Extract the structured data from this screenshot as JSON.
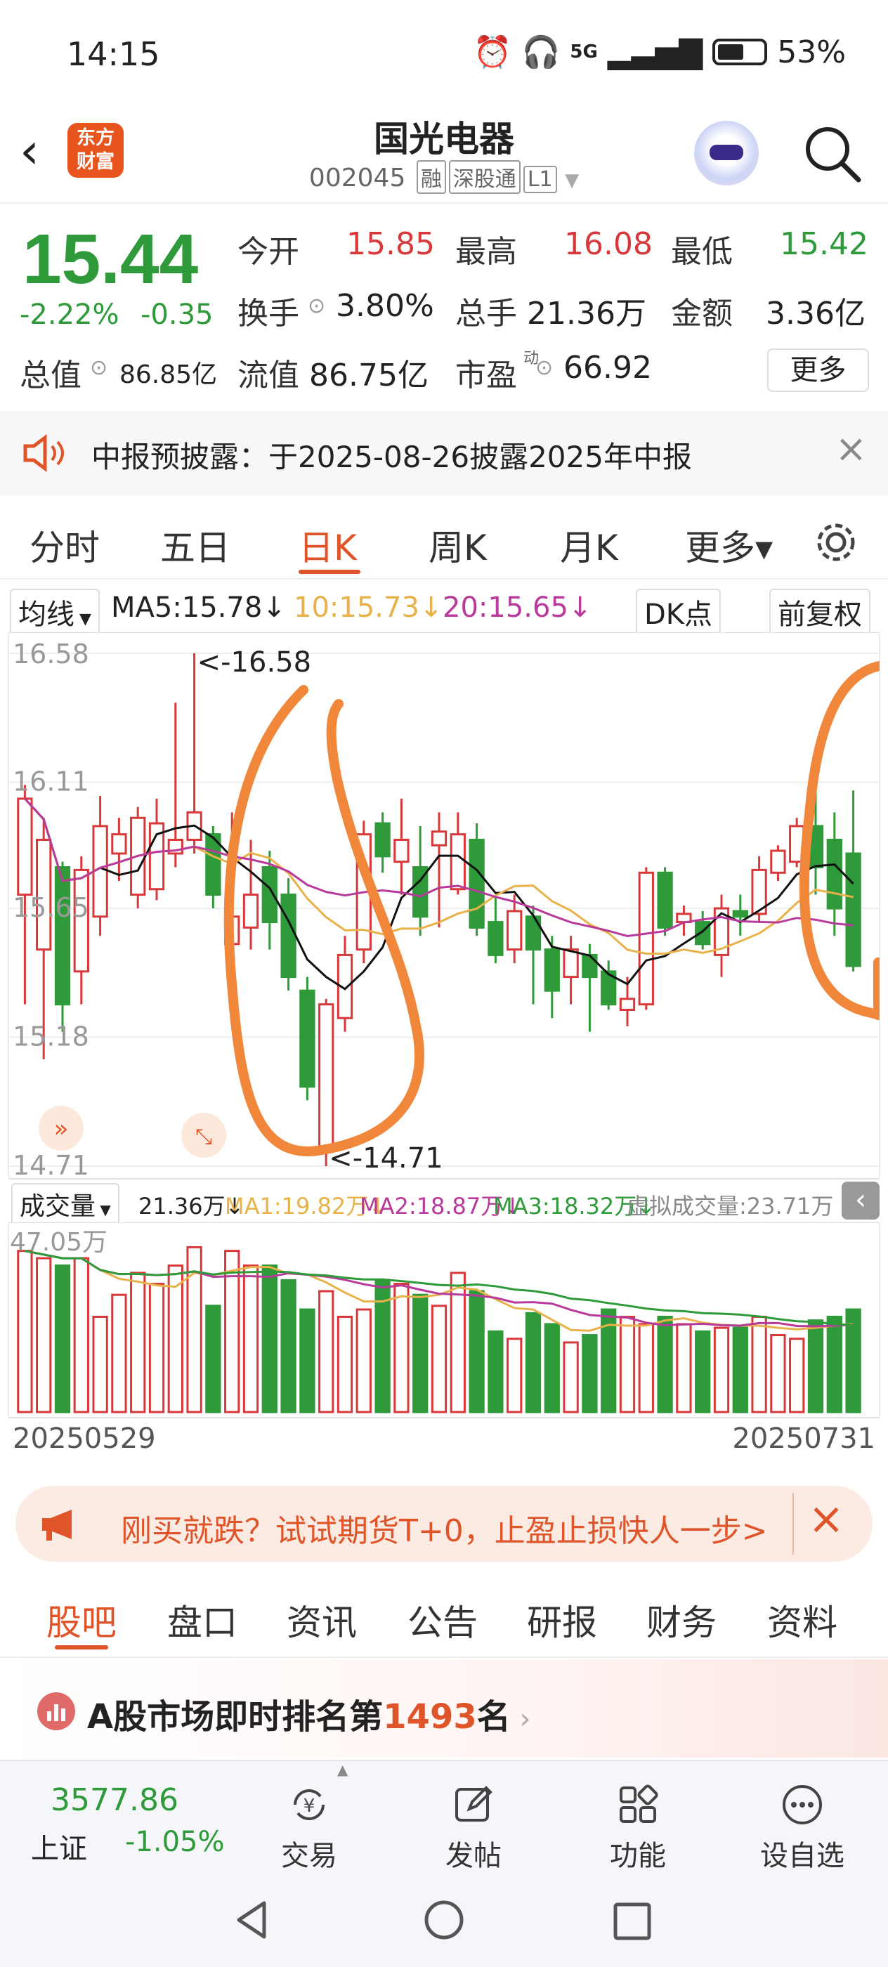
{
  "status": {
    "time": "14:15",
    "network": "5G",
    "battery": "53%"
  },
  "header": {
    "title": "国光电器",
    "code": "002045",
    "tags": [
      "融",
      "深股通",
      "L1"
    ],
    "logo_line1": "东方",
    "logo_line2": "财富"
  },
  "quote": {
    "price": "15.44",
    "change_pct": "-2.22%",
    "change": "-0.35",
    "open_label": "今开",
    "open": "15.85",
    "high_label": "最高",
    "high": "16.08",
    "low_label": "最低",
    "low": "15.42",
    "turnover_label": "换手",
    "turnover": "3.80%",
    "volume_label": "总手",
    "volume": "21.36万",
    "amount_label": "金额",
    "amount": "3.36亿",
    "mktcap_label": "总值",
    "mktcap": "86.85亿",
    "float_label": "流值",
    "float": "86.75亿",
    "pe_label": "市盈",
    "pe_sup": "动",
    "pe": "66.92",
    "more": "更多"
  },
  "notice": {
    "text": "中报预披露：于2025-08-26披露2025年中报"
  },
  "tabs": [
    "分时",
    "五日",
    "日K",
    "周K",
    "月K",
    "更多▾"
  ],
  "ma": {
    "select": "均线",
    "ma5": "MA5:15.78↓",
    "ma10": "10:15.73↓",
    "ma20": "20:15.65↓",
    "dk": "DK点",
    "fq": "前复权"
  },
  "chart_data": {
    "type": "candlestick",
    "y_ticks": [
      "16.58",
      "16.11",
      "15.65",
      "15.18",
      "14.71"
    ],
    "ylim": [
      14.71,
      16.58
    ],
    "max_label": "<-16.58",
    "min_label": "<-14.71",
    "start_date": "20250529",
    "end_date": "20250731",
    "candles": [
      [
        15.7,
        16.05,
        16.1,
        15.3
      ],
      [
        15.5,
        15.9,
        15.98,
        15.1
      ],
      [
        15.8,
        15.3,
        15.82,
        15.2
      ],
      [
        15.42,
        15.79,
        15.84,
        15.3
      ],
      [
        15.62,
        15.95,
        16.06,
        15.55
      ],
      [
        15.85,
        15.92,
        15.98,
        15.75
      ],
      [
        15.7,
        15.98,
        16.02,
        15.65
      ],
      [
        15.72,
        15.96,
        16.05,
        15.68
      ],
      [
        15.85,
        15.9,
        16.4,
        15.8
      ],
      [
        15.9,
        16.0,
        16.58,
        15.85
      ],
      [
        15.92,
        15.7,
        15.95,
        15.65
      ],
      [
        15.52,
        15.62,
        16.0,
        15.48
      ],
      [
        15.58,
        15.7,
        15.9,
        15.5
      ],
      [
        15.8,
        15.6,
        15.86,
        15.5
      ],
      [
        15.7,
        15.4,
        15.76,
        15.35
      ],
      [
        15.35,
        15.0,
        15.4,
        14.95
      ],
      [
        14.78,
        15.3,
        15.32,
        14.71
      ],
      [
        15.25,
        15.48,
        15.55,
        15.2
      ],
      [
        15.5,
        15.92,
        15.97,
        15.45
      ],
      [
        15.96,
        15.84,
        16.0,
        15.78
      ],
      [
        15.82,
        15.9,
        16.05,
        15.7
      ],
      [
        15.8,
        15.62,
        15.95,
        15.55
      ],
      [
        15.88,
        15.93,
        16.0,
        15.58
      ],
      [
        15.72,
        15.92,
        16.0,
        15.7
      ],
      [
        15.9,
        15.58,
        15.96,
        15.55
      ],
      [
        15.6,
        15.48,
        15.7,
        15.45
      ],
      [
        15.5,
        15.64,
        15.7,
        15.45
      ],
      [
        15.62,
        15.5,
        15.66,
        15.3
      ],
      [
        15.5,
        15.35,
        15.55,
        15.25
      ],
      [
        15.4,
        15.5,
        15.55,
        15.3
      ],
      [
        15.48,
        15.4,
        15.52,
        15.2
      ],
      [
        15.42,
        15.3,
        15.46,
        15.28
      ],
      [
        15.28,
        15.32,
        15.4,
        15.22
      ],
      [
        15.3,
        15.78,
        15.8,
        15.28
      ],
      [
        15.78,
        15.58,
        15.8,
        15.55
      ],
      [
        15.6,
        15.63,
        15.66,
        15.55
      ],
      [
        15.6,
        15.52,
        15.64,
        15.5
      ],
      [
        15.48,
        15.65,
        15.7,
        15.4
      ],
      [
        15.64,
        15.62,
        15.7,
        15.55
      ],
      [
        15.63,
        15.79,
        15.84,
        15.6
      ],
      [
        15.78,
        15.86,
        15.88,
        15.75
      ],
      [
        15.82,
        15.95,
        15.98,
        15.8
      ],
      [
        15.95,
        15.8,
        16.18,
        15.7
      ],
      [
        15.9,
        15.65,
        16.0,
        15.55
      ],
      [
        15.85,
        15.44,
        16.08,
        15.42
      ]
    ]
  },
  "volume": {
    "select": "成交量",
    "vol": "21.36万↓",
    "ma1": "MA1:19.82万↓",
    "ma2": "MA2:18.87万↓",
    "ma3": "MA3:18.32万↓",
    "virtual": "虚拟成交量:23.71万",
    "max_label": "47.05万"
  },
  "ad": {
    "text": "刚买就跌？试试期货T+0，止盈止损快人一步>"
  },
  "subtabs": [
    "股吧",
    "盘口",
    "资讯",
    "公告",
    "研报",
    "财务",
    "资料"
  ],
  "rank": {
    "prefix": "A股市场即时排名第",
    "rank": "1493",
    "suffix": "名"
  },
  "index": {
    "value": "3577.86",
    "name": "上证",
    "change": "-1.05%"
  },
  "nav": [
    "交易",
    "发帖",
    "功能",
    "设自选"
  ],
  "colors": {
    "up": "#d9383a",
    "down": "#2e9a3a",
    "accent": "#e0542a",
    "ma5": "#111111",
    "ma10": "#e8b24a",
    "ma20": "#b83a9a",
    "annotation": "#f0873a"
  }
}
